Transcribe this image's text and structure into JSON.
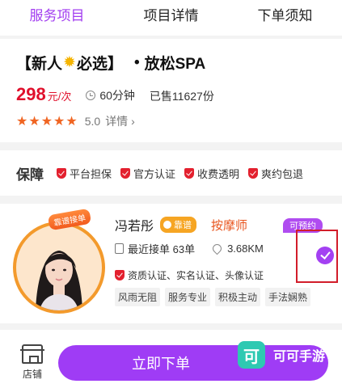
{
  "tabs": [
    {
      "label": "服务项目",
      "active": true
    },
    {
      "label": "项目详情",
      "active": false
    },
    {
      "label": "下单须知",
      "active": false
    }
  ],
  "service": {
    "title_prefix": "【新人",
    "title_badge_icon": "star-badge-icon",
    "title_mid": "必选】",
    "title_dot": "•",
    "title_name": "放松SPA",
    "price": "298",
    "price_unit": "元/次",
    "duration": "60分钟",
    "sold": "已售11627份",
    "stars": "★★★★★",
    "rating": 5.0,
    "rating_text": "5.0",
    "detail_link": "详情 ›"
  },
  "guarantee": {
    "label": "保障",
    "items": [
      "平台担保",
      "官方认证",
      "收费透明",
      "爽约包退"
    ]
  },
  "technician": {
    "name": "冯若彤",
    "language_badge": "靠谱",
    "role": "按摩师",
    "speed_badge": "靠谱接单",
    "bookable_badge": "可预约",
    "recent_orders": "最近接单 63单",
    "distance": "3.68KM",
    "certifications": "资质认证、实名认证、头像认证",
    "tags": [
      "风雨无阻",
      "服务专业",
      "积极主动",
      "手法娴熟"
    ],
    "selected": true
  },
  "bottom_bar": {
    "store_label": "店铺",
    "order_button": "立即下单"
  },
  "watermark": {
    "logo_text": "可",
    "text": "可可手游"
  },
  "colors": {
    "accent": "#9f3cf5",
    "price": "#e0102c",
    "star": "#f06522",
    "shield": "#e3202e"
  }
}
